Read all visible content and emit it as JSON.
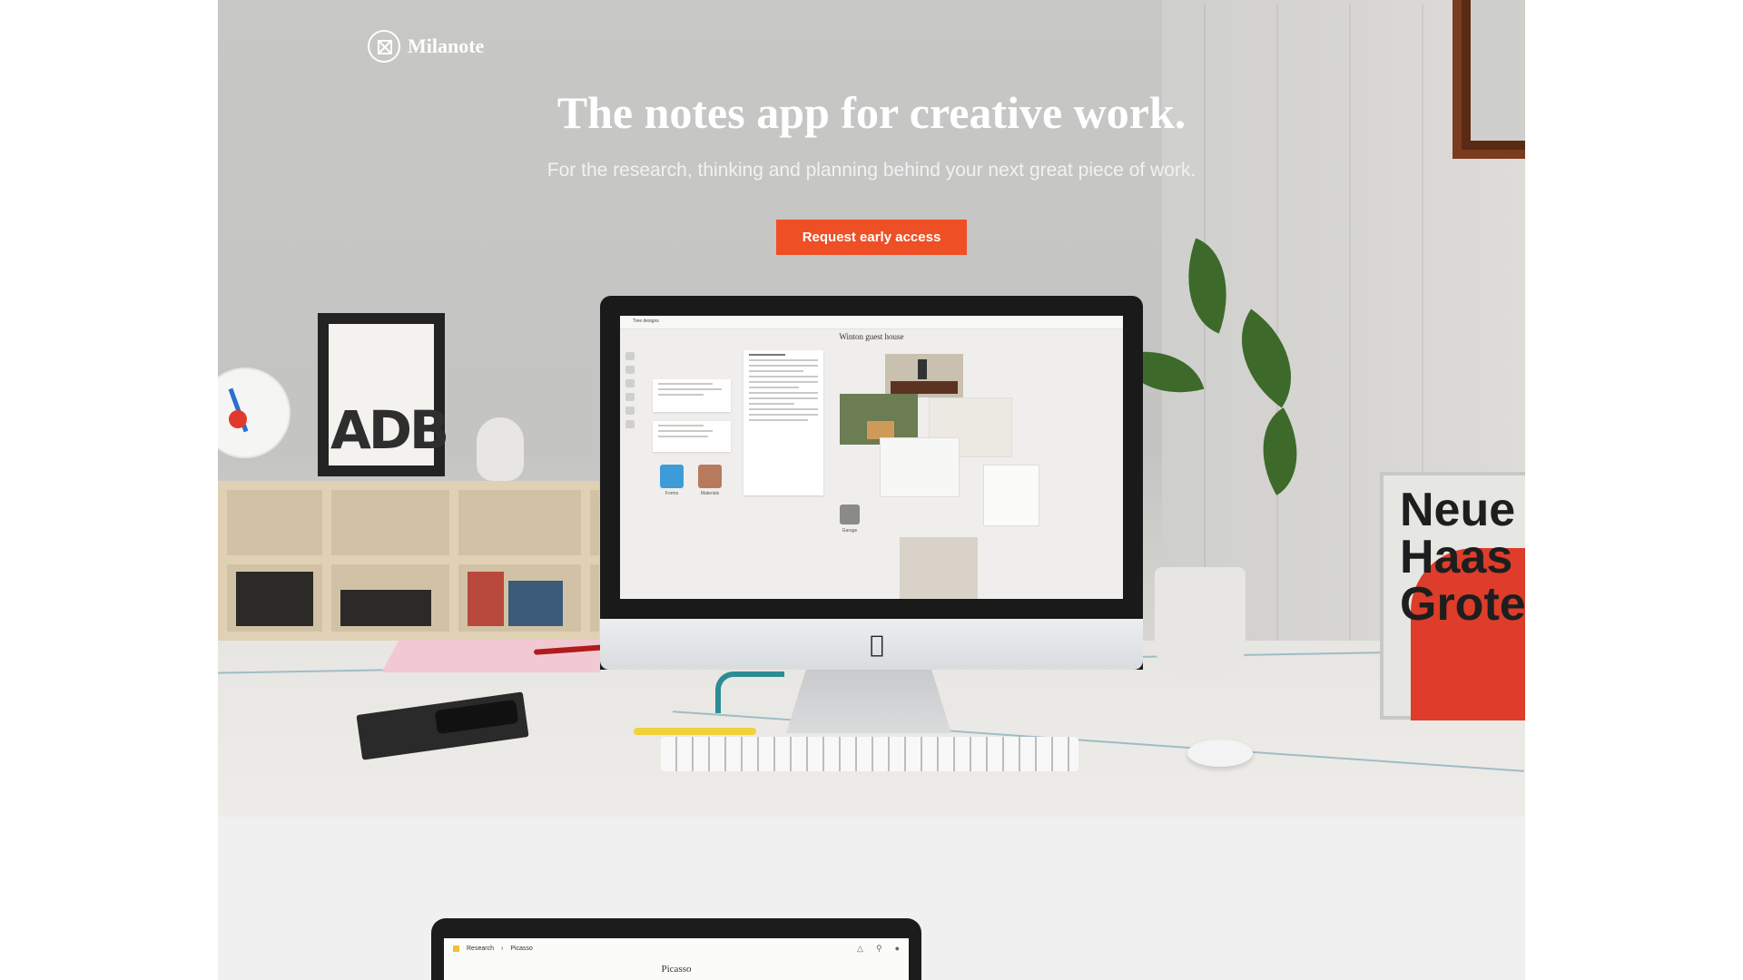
{
  "brand": {
    "name": "Milanote"
  },
  "hero": {
    "headline": "The notes app for creative work.",
    "subheadline": "For the research, thinking and planning behind your next great piece of work.",
    "cta_label": "Request early access",
    "accent_color": "#ee4f25",
    "poster_text": "Neue\nHaas\nGrote",
    "frame_text": "ADB"
  },
  "imac_app": {
    "breadcrumb": "Tree designs",
    "board_title": "Winton guest house",
    "tiles": [
      "Forms",
      "Materials",
      "Garage"
    ]
  },
  "laptop_app": {
    "breadcrumb_root": "Research",
    "breadcrumb_child": "Picasso",
    "board_title": "Picasso"
  }
}
